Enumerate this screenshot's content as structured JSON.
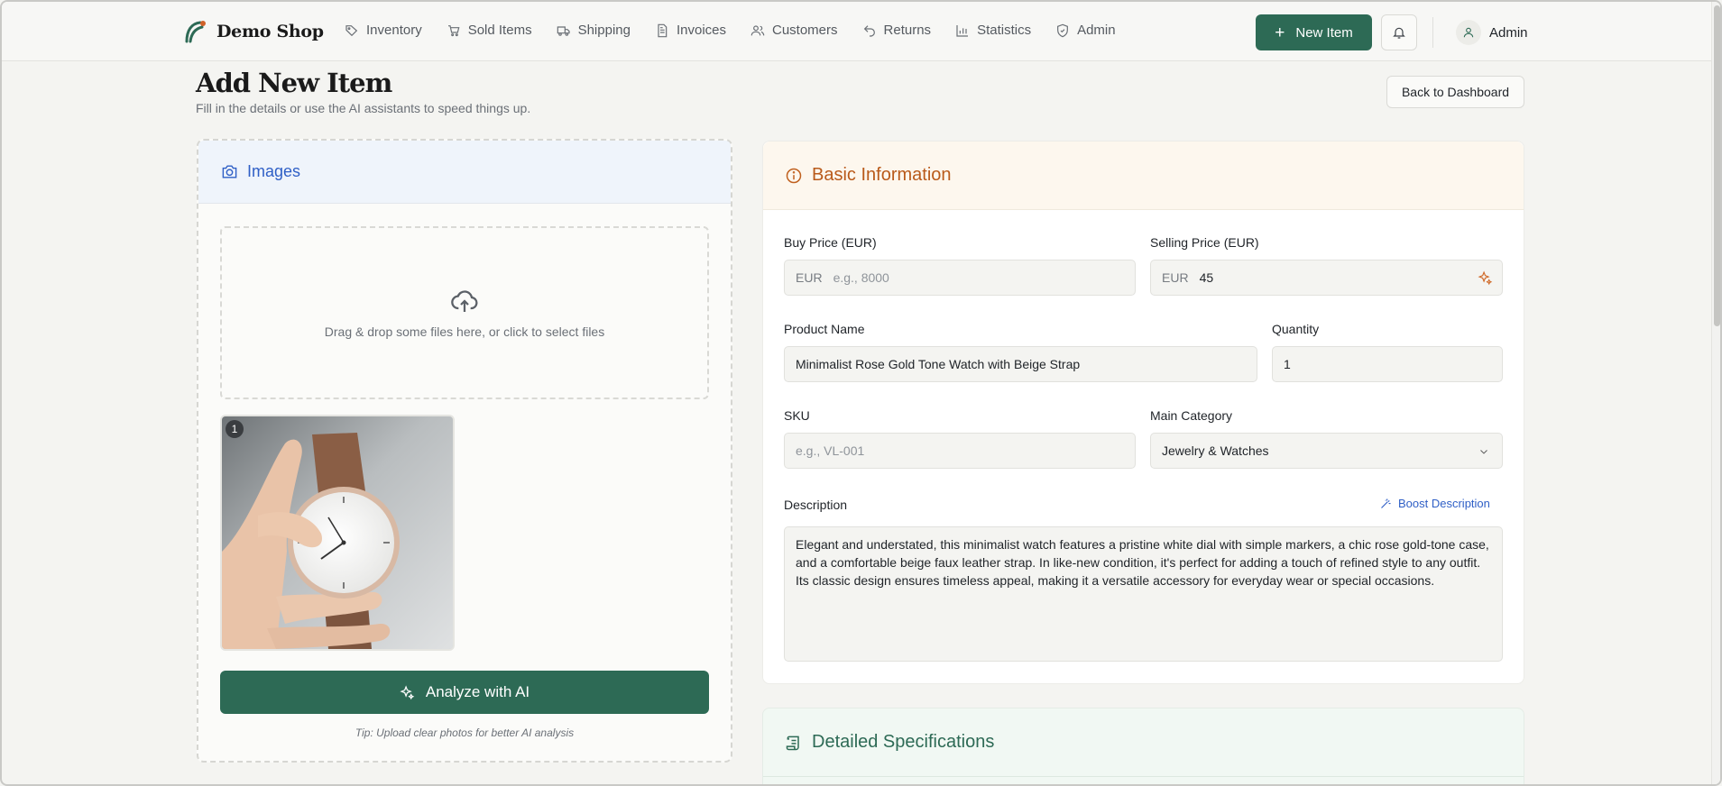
{
  "header": {
    "brand": "Demo Shop",
    "nav": [
      {
        "label": "Inventory",
        "icon": "tag-icon"
      },
      {
        "label": "Sold Items",
        "icon": "cart-icon"
      },
      {
        "label": "Shipping",
        "icon": "truck-icon"
      },
      {
        "label": "Invoices",
        "icon": "document-icon"
      },
      {
        "label": "Customers",
        "icon": "users-icon"
      },
      {
        "label": "Returns",
        "icon": "return-icon"
      },
      {
        "label": "Statistics",
        "icon": "bar-chart-icon"
      },
      {
        "label": "Admin",
        "icon": "shield-icon"
      }
    ],
    "new_item_label": "New Item",
    "user_name": "Admin"
  },
  "page": {
    "title": "Add New Item",
    "subtitle": "Fill in the details or use the AI assistants to speed things up.",
    "back_label": "Back to Dashboard"
  },
  "images": {
    "title": "Images",
    "dropzone_text": "Drag & drop some files here, or click to select files",
    "thumb_number": "1",
    "analyze_label": "Analyze with AI",
    "tip": "Tip: Upload clear photos for better AI analysis"
  },
  "basic": {
    "title": "Basic Information",
    "buy_price_label": "Buy Price (EUR)",
    "buy_price_prefix": "EUR",
    "buy_price_placeholder": "e.g., 8000",
    "selling_price_label": "Selling Price (EUR)",
    "selling_price_prefix": "EUR",
    "selling_price_value": "45",
    "product_name_label": "Product Name",
    "product_name_value": "Minimalist Rose Gold Tone Watch with Beige Strap",
    "quantity_label": "Quantity",
    "quantity_value": "1",
    "sku_label": "SKU",
    "sku_placeholder": "e.g., VL-001",
    "category_label": "Main Category",
    "category_value": "Jewelry & Watches",
    "description_label": "Description",
    "boost_label": "Boost Description",
    "description_value": "Elegant and understated, this minimalist watch features a pristine white dial with simple markers, a chic rose gold-tone case, and a comfortable beige faux leather strap. In like-new condition, it's perfect for adding a touch of refined style to any outfit. Its classic design ensures timeless appeal, making it a versatile accessory for everyday wear or special occasions."
  },
  "specs": {
    "title": "Detailed Specifications"
  },
  "colors": {
    "primary": "#2d6a55",
    "blue_accent": "#2f5fc6",
    "orange_accent": "#b95a1a"
  }
}
